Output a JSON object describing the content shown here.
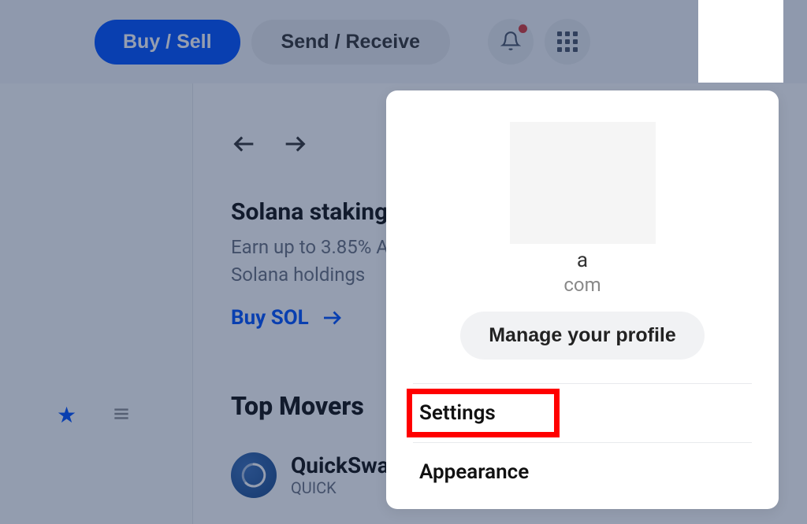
{
  "topbar": {
    "buy_sell_label": "Buy / Sell",
    "send_receive_label": "Send / Receive"
  },
  "promo": {
    "title": "Solana staking",
    "description_line1": "Earn up to 3.85% A",
    "description_line2": "Solana holdings",
    "link_label": "Buy SOL"
  },
  "section": {
    "top_movers_label": "Top Movers"
  },
  "movers": [
    {
      "name": "QuickSwa",
      "symbol": "QUICK"
    }
  ],
  "dropdown": {
    "profile_name_fragment": "a",
    "profile_email_fragment": "com",
    "manage_label": "Manage your profile",
    "menu": [
      {
        "label": "Settings",
        "highlighted": true
      },
      {
        "label": "Appearance",
        "highlighted": false
      }
    ]
  }
}
